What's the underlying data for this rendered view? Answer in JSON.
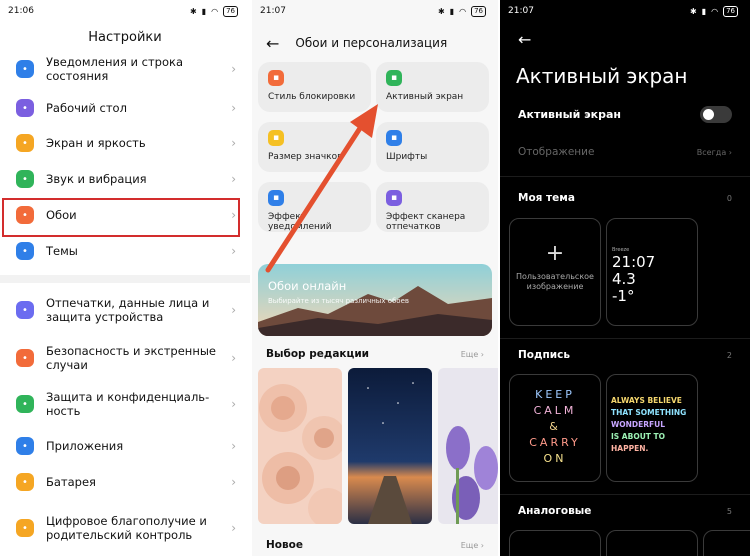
{
  "panel1": {
    "time": "21:06",
    "battery": "76",
    "title": "Настройки",
    "items": [
      {
        "label": "Уведомления и строка состояния",
        "icon": "notification-icon",
        "color": "#2f7fe8"
      },
      {
        "label": "Рабочий стол",
        "icon": "home-icon",
        "color": "#7b5fe0"
      },
      {
        "label": "Экран и яркость",
        "icon": "sun-icon",
        "color": "#f5a623"
      },
      {
        "label": "Звук и вибрация",
        "icon": "speaker-icon",
        "color": "#30b45a"
      },
      {
        "label": "Обои",
        "icon": "wallpaper-icon",
        "color": "#f26b3a"
      },
      {
        "label": "Темы",
        "icon": "brush-icon",
        "color": "#2f7fe8"
      },
      {
        "label": "Отпечатки, данные лица и защита устройства",
        "icon": "fingerprint-icon",
        "color": "#6b6cf0"
      },
      {
        "label": "Безопасность и экстренные случаи",
        "icon": "sos-icon",
        "color": "#f26b3a"
      },
      {
        "label": "Защита и конфиденциаль-ность",
        "icon": "shield-icon",
        "color": "#30b45a"
      },
      {
        "label": "Приложения",
        "icon": "apps-icon",
        "color": "#2f7fe8"
      },
      {
        "label": "Батарея",
        "icon": "battery-icon",
        "color": "#f5a623"
      },
      {
        "label": "Цифровое благополучие и родительский контроль",
        "icon": "wellbeing-icon",
        "color": "#f5a623"
      }
    ]
  },
  "panel2": {
    "time": "21:07",
    "battery": "76",
    "title": "Обои и персонализация",
    "tiles": [
      {
        "label": "Стиль блокировки",
        "icon": "lock-style-icon",
        "color": "#f26b3a"
      },
      {
        "label": "Активный экран",
        "icon": "active-screen-icon",
        "color": "#30b45a"
      },
      {
        "label": "Размер значков",
        "icon": "icon-size-icon",
        "color": "#f5c023"
      },
      {
        "label": "Шрифты",
        "icon": "font-icon",
        "color": "#2f7fe8"
      },
      {
        "label": "Эффект уведомлений",
        "icon": "notification-effect-icon",
        "color": "#2f7fe8"
      },
      {
        "label": "Эффект сканера отпечатков",
        "icon": "fingerprint-icon",
        "color": "#7b5fe0"
      }
    ],
    "banner_title": "Обои онлайн",
    "banner_subtitle": "Выбирайте из тысяч различных обоев",
    "section_editors": "Выбор редакции",
    "section_new": "Новое",
    "more": "Еще"
  },
  "panel3": {
    "time": "21:07",
    "battery": "76",
    "title": "Активный экран",
    "toggle_label": "Активный экран",
    "display_label": "Отображение",
    "display_value": "Всегда",
    "section_theme": "Моя тема",
    "theme_count": "0",
    "custom_image_label": "Пользовательское изображение",
    "clock_city": "Breeze",
    "clock_time": "21:07",
    "clock_date": "4.3",
    "clock_temp": "-1°",
    "section_signature": "Подпись",
    "signature_count": "2",
    "keep_calm_lines": [
      "KEEP",
      "CALM",
      "&",
      "CARRY",
      "ON"
    ],
    "believe_lines": [
      "ALWAYS BELIEVE",
      "THAT SOMETHING",
      "WONDERFUL",
      "IS ABOUT TO",
      "HAPPEN."
    ],
    "section_analog": "Аналоговые",
    "analog_count": "5"
  }
}
